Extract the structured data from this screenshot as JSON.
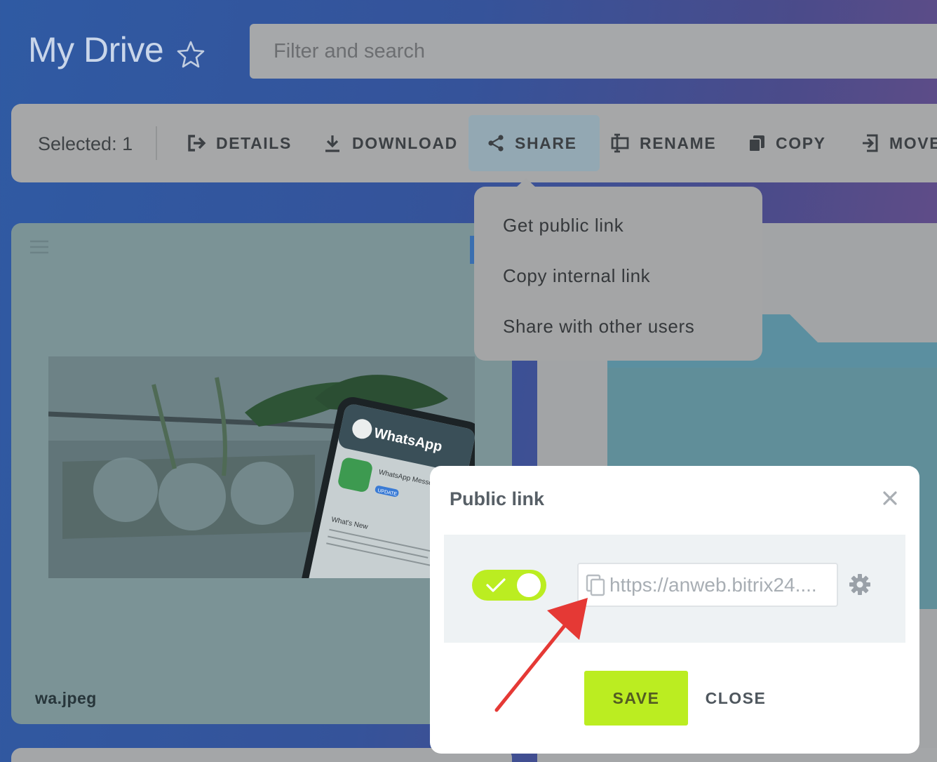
{
  "header": {
    "title": "My Drive",
    "search_placeholder": "Filter and search"
  },
  "toolbar": {
    "selected_label": "Selected: 1",
    "buttons": [
      {
        "label": "DETAILS",
        "icon": "details-icon"
      },
      {
        "label": "DOWNLOAD",
        "icon": "download-icon"
      },
      {
        "label": "SHARE",
        "icon": "share-icon",
        "active": true
      },
      {
        "label": "RENAME",
        "icon": "rename-icon"
      },
      {
        "label": "COPY",
        "icon": "copy-icon"
      },
      {
        "label": "MOVE",
        "icon": "move-icon"
      }
    ]
  },
  "share_menu": {
    "items": [
      "Get public link",
      "Copy internal link",
      "Share with other users"
    ]
  },
  "files": [
    {
      "name": "wa.jpeg",
      "type": "image"
    }
  ],
  "thumbnail": {
    "app_name": "WhatsApp",
    "app_listing": "WhatsApp Messenger",
    "update_label": "UPDATE",
    "section": "What's New"
  },
  "modal": {
    "title": "Public link",
    "toggle_on": true,
    "link_value": "https://anweb.bitrix24....",
    "save_label": "SAVE",
    "close_label": "CLOSE"
  },
  "colors": {
    "accent_green": "#bbed21",
    "overlay_gray": "#a6a7a8",
    "annotation_red": "#e53935"
  }
}
